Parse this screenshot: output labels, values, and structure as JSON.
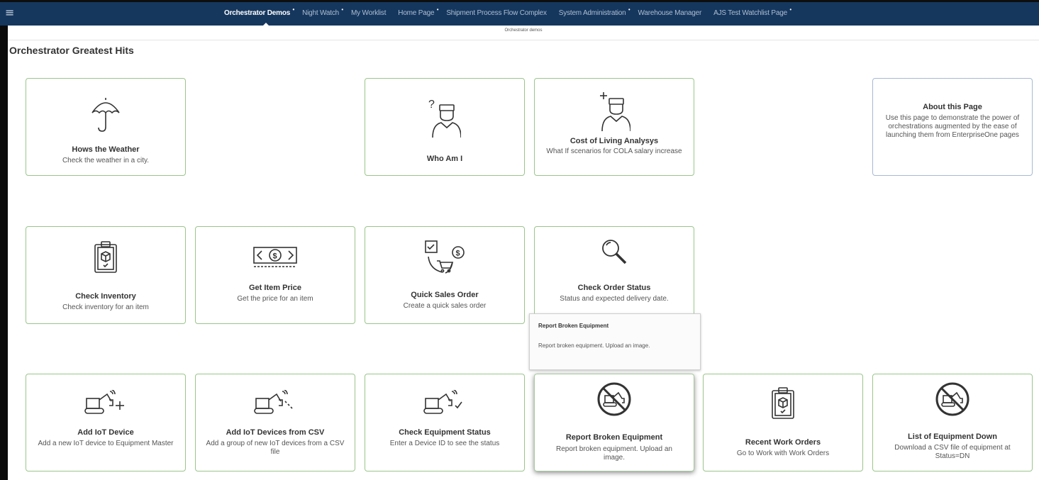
{
  "nav": {
    "menu_icon": "hamburger-menu-icon",
    "tabs": [
      {
        "label": "Orchestrator Demos",
        "active": true,
        "dot": "•"
      },
      {
        "label": "Night Watch",
        "dot": "•"
      },
      {
        "label": "My Worklist"
      },
      {
        "label": "Home Page",
        "dot": "•"
      },
      {
        "label": "Shipment Process Flow Complex"
      },
      {
        "label": "System Administration",
        "dot": "•"
      },
      {
        "label": "Warehouse Manager"
      },
      {
        "label": "AJS Test Watchlist Page",
        "dot": "•"
      }
    ],
    "subtitle": "Orchestrator demos"
  },
  "page": {
    "title": "Orchestrator Greatest Hits"
  },
  "tiles": [
    {
      "title": "Hows the Weather",
      "desc": "Check the weather in a city.",
      "icon": "umbrella-icon"
    },
    {
      "title": "Who Am I",
      "desc": "",
      "icon": "person-question-icon"
    },
    {
      "title": "Cost of Living Analysys",
      "desc": "What If scenarios for COLA salary increase",
      "icon": "person-plus-icon"
    },
    {
      "title": "About this Page",
      "desc": "Use this page to demonstrate the power of orchestrations augmented by the ease of launching them from EnterpriseOne pages"
    },
    {
      "title": "Check Inventory",
      "desc": "Check inventory for an item",
      "icon": "clipboard-box-icon"
    },
    {
      "title": "Get Item Price",
      "desc": "Get the price for an item",
      "icon": "dollar-bill-icon"
    },
    {
      "title": "Quick Sales Order",
      "desc": "Create a quick sales order",
      "icon": "cart-cycle-icon"
    },
    {
      "title": "Check Order Status",
      "desc": "Status and expected delivery date.",
      "icon": "magnifier-icon"
    },
    {
      "title": "Add IoT Device",
      "desc": "Add a new IoT device to Equipment Master",
      "icon": "excavator-plus-icon"
    },
    {
      "title": "Add IoT Devices from CSV",
      "desc": "Add a group of new IoT devices from a CSV file",
      "icon": "excavator-dots-icon"
    },
    {
      "title": "Check Equipment Status",
      "desc": "Enter a Device ID to see the status",
      "icon": "excavator-check-icon"
    },
    {
      "title": "Report Broken Equipment",
      "desc": "Report broken equipment. Upload an image.",
      "icon": "excavator-prohibited-icon"
    },
    {
      "title": "Recent Work Orders",
      "desc": "Go to Work with Work Orders",
      "icon": "clipboard-box-icon"
    },
    {
      "title": "List of Equipment Down",
      "desc": "Download a CSV file of equipment at Status=DN",
      "icon": "excavator-prohibited-icon"
    }
  ],
  "tooltip": {
    "title": "Report Broken Equipment",
    "body": "Report broken equipment. Upload an image."
  },
  "colors": {
    "nav_bg": "#15375e",
    "tile_border": "#9bc58c",
    "about_border": "#a7b9d3"
  }
}
